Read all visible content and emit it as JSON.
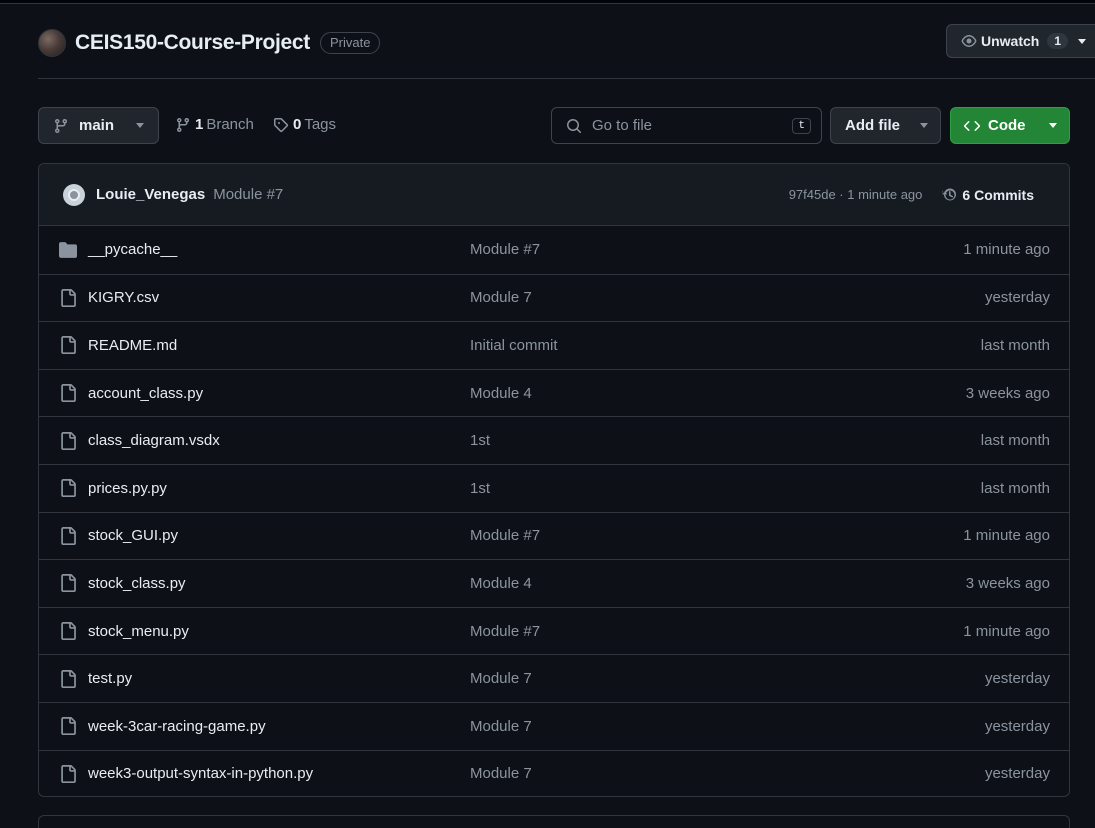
{
  "repo": {
    "name": "CEIS150-Course-Project",
    "visibility": "Private"
  },
  "watch": {
    "label": "Unwatch",
    "count": "1"
  },
  "branch": {
    "current": "main"
  },
  "meta": {
    "branches_count": "1",
    "branches_label": "Branch",
    "tags_count": "0",
    "tags_label": "Tags"
  },
  "search": {
    "placeholder": "Go to file",
    "shortcut": "t"
  },
  "actions": {
    "add_file": "Add file",
    "code": "Code"
  },
  "commit": {
    "author": "Louie_Venegas",
    "message": "Module #7",
    "sha_time": "97f45de · 1 minute ago",
    "commits_count": "6",
    "commits_label": "Commits"
  },
  "files": [
    {
      "name": "__pycache__",
      "type": "folder",
      "message": "Module #7",
      "date": "1 minute ago"
    },
    {
      "name": "KIGRY.csv",
      "type": "file",
      "message": "Module 7",
      "date": "yesterday"
    },
    {
      "name": "README.md",
      "type": "file",
      "message": "Initial commit",
      "date": "last month"
    },
    {
      "name": "account_class.py",
      "type": "file",
      "message": "Module 4",
      "date": "3 weeks ago"
    },
    {
      "name": "class_diagram.vsdx",
      "type": "file",
      "message": "1st",
      "date": "last month"
    },
    {
      "name": "prices.py.py",
      "type": "file",
      "message": "1st",
      "date": "last month"
    },
    {
      "name": "stock_GUI.py",
      "type": "file",
      "message": "Module #7",
      "date": "1 minute ago"
    },
    {
      "name": "stock_class.py",
      "type": "file",
      "message": "Module 4",
      "date": "3 weeks ago"
    },
    {
      "name": "stock_menu.py",
      "type": "file",
      "message": "Module #7",
      "date": "1 minute ago"
    },
    {
      "name": "test.py",
      "type": "file",
      "message": "Module 7",
      "date": "yesterday"
    },
    {
      "name": "week-3car-racing-game.py",
      "type": "file",
      "message": "Module 7",
      "date": "yesterday"
    },
    {
      "name": "week3-output-syntax-in-python.py",
      "type": "file",
      "message": "Module 7",
      "date": "yesterday"
    }
  ],
  "colors": {
    "background": "#0d1117",
    "border": "#30363d",
    "accent_green": "#238636",
    "muted_text": "#8b949e",
    "text": "#e6edf3"
  }
}
